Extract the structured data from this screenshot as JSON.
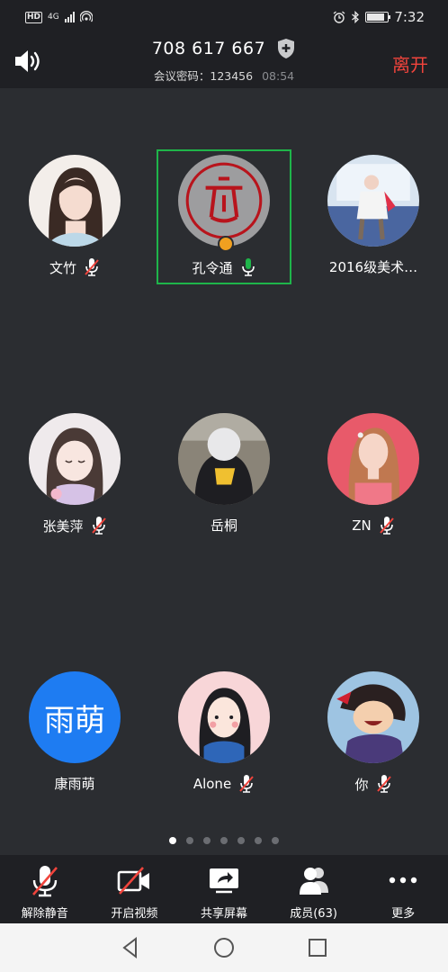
{
  "status_bar": {
    "network_badge": "HD",
    "network_type": "4G",
    "time": "7:32",
    "icons": [
      "hd-icon",
      "signal-icon",
      "hotspot-icon",
      "alarm-icon",
      "bluetooth-icon",
      "battery-icon"
    ]
  },
  "header": {
    "meeting_id": "708 617 667",
    "password_text": "会议密码：123456",
    "duration": "08:54",
    "leave_label": "离开",
    "leave_color": "#f0443c"
  },
  "participants": [
    {
      "name": "文竹",
      "muted": true
    },
    {
      "name": "孔令通",
      "muted": false,
      "active": true,
      "host": true
    },
    {
      "name": "2016级美术…",
      "muted": false
    },
    {
      "name": "张美萍",
      "muted": true
    },
    {
      "name": "岳桐",
      "muted": false
    },
    {
      "name": "ZN",
      "muted": true
    },
    {
      "name": "康雨萌",
      "muted": false,
      "avatar_text": "雨萌"
    },
    {
      "name": "Alone",
      "muted": true
    },
    {
      "name": "你",
      "muted": true
    }
  ],
  "pager": {
    "pages": 7,
    "current": 1
  },
  "toolbar": {
    "unmute_label": "解除静音",
    "video_label": "开启视频",
    "share_label": "共享屏幕",
    "members_label": "成员(63)",
    "more_label": "更多"
  },
  "colors": {
    "background": "#2b2d31",
    "bar": "#1f2024",
    "active_border": "#1fb54a",
    "muted_red": "#f0443c",
    "text_avatar": "#1e7cf2"
  }
}
